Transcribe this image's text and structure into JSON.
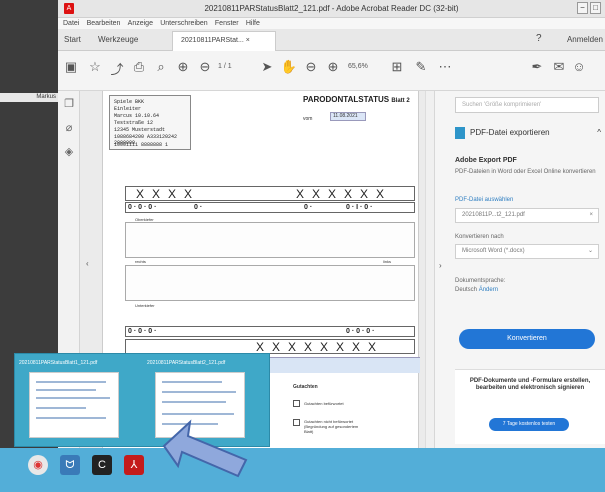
{
  "window": {
    "title": "20210811PARStatusBlatt2_121.pdf - Adobe Acrobat Reader DC (32-bit)",
    "minimize": "−",
    "maximize": "□"
  },
  "left_pane": {
    "label": "Markus"
  },
  "menu": [
    "Datei",
    "Bearbeiten",
    "Anzeige",
    "Unterschreiben",
    "Fenster",
    "Hilfe"
  ],
  "tabs": {
    "start": "Start",
    "tools": "Werkzeuge",
    "doc": "20210811PARStat...  ×",
    "signin": "Anmelden",
    "help_icon": "?"
  },
  "toolbar": {
    "page": "1 / 1",
    "zoom": "65,6%"
  },
  "pdf": {
    "title": "PARODONTALSTATUS",
    "title_suffix": "Blatt 2",
    "vom_label": "vom",
    "date": "11.08.2021",
    "card_lines": [
      "Spiele BKK",
      "Einleiter",
      "Marcus     10.10.64",
      "Teststraße 12",
      "12345 Musterstadt",
      "1088684200  A333120242  2000000",
      "10001111  8888888  1"
    ],
    "upper_label": "Oberkiefer",
    "lower_label": "Unterkiefer",
    "rechts": "rechts",
    "links": "links",
    "gutachten": "Gutachten",
    "check1": "Gutachten befürwortet",
    "check2": "Gutachten nicht befürwortet (Begründung auf gesondertem Blatt)"
  },
  "panel": {
    "search_placeholder": "Suchen 'Größe komprimieren'",
    "export_tool": "PDF-Datei exportieren",
    "heading": "Adobe Export PDF",
    "desc": "PDF-Dateien in Word oder Excel Online konvertieren",
    "choose_label": "PDF-Datei auswählen",
    "file": "20210811P...t2_121.pdf",
    "convert_to_label": "Konvertieren nach",
    "format": "Microsoft Word (*.docx)",
    "lang_label": "Dokumentsprache:",
    "lang_value": "Deutsch",
    "lang_change": "Ändern",
    "convert_button": "Konvertieren",
    "promo_text": "PDF-Dokumente und -Formulare erstellen, bearbeiten und elektronisch signieren",
    "promo_button": "7 Tage kostenlos testen"
  },
  "taskbar": {
    "thumb1_label": "20210811PARStatusBlatt1_121.pdf",
    "thumb2_label": "20210811PARStatusBlatt2_121.pdf"
  },
  "colors": {
    "accent": "#2276d6",
    "taskbar": "#53aed8",
    "acrobat_red": "#d11"
  }
}
